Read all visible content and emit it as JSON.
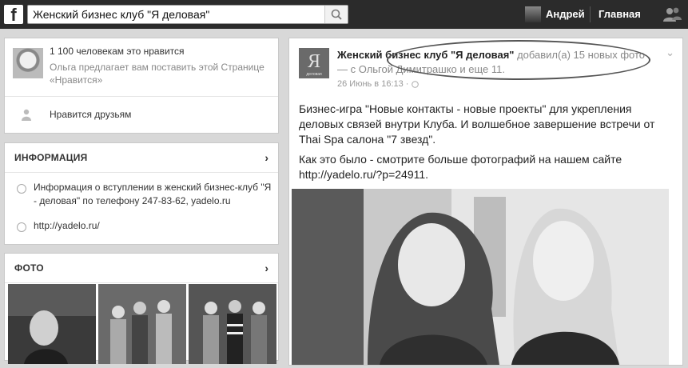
{
  "topbar": {
    "logo": "f",
    "search_value": "Женский бизнес клуб \"Я деловая\"",
    "user_name": "Андрей",
    "home_label": "Главная"
  },
  "likes": {
    "count_text": "1 100 человекам это нравится",
    "suggest_text": "Ольга предлагает вам поставить этой Странице «Нравится»",
    "friends_like": "Нравится друзьям"
  },
  "info": {
    "title": "ИНФОРМАЦИЯ",
    "chevron": "›",
    "description": "Информация о вступлении в женский бизнес-клуб \"Я - деловая\" по телефону 247-83-62, yadelo.ru",
    "website": "http://yadelo.ru/"
  },
  "photos": {
    "title": "ФОТО",
    "chevron": "›"
  },
  "post": {
    "logo_letter": "Я",
    "logo_caption": "деловая",
    "page_name": "Женский бизнес клуб \"Я деловая\"",
    "added_text": " добавил(а) 15 новых фото — с Ольгой Димитрашко и еще 11.",
    "date": "26 Июнь в 16:13 · ",
    "menu": "⌄",
    "text_1": "Бизнес-игра \"Новые контакты - новые проекты\" для укрепления деловых связей внутри Клуба. И волшебное завершение встречи от Thai Spa салона \"7 звезд\".",
    "text_2": "Как это было - смотрите больше фотографий на нашем сайте http://yadelo.ru/?p=24911."
  }
}
